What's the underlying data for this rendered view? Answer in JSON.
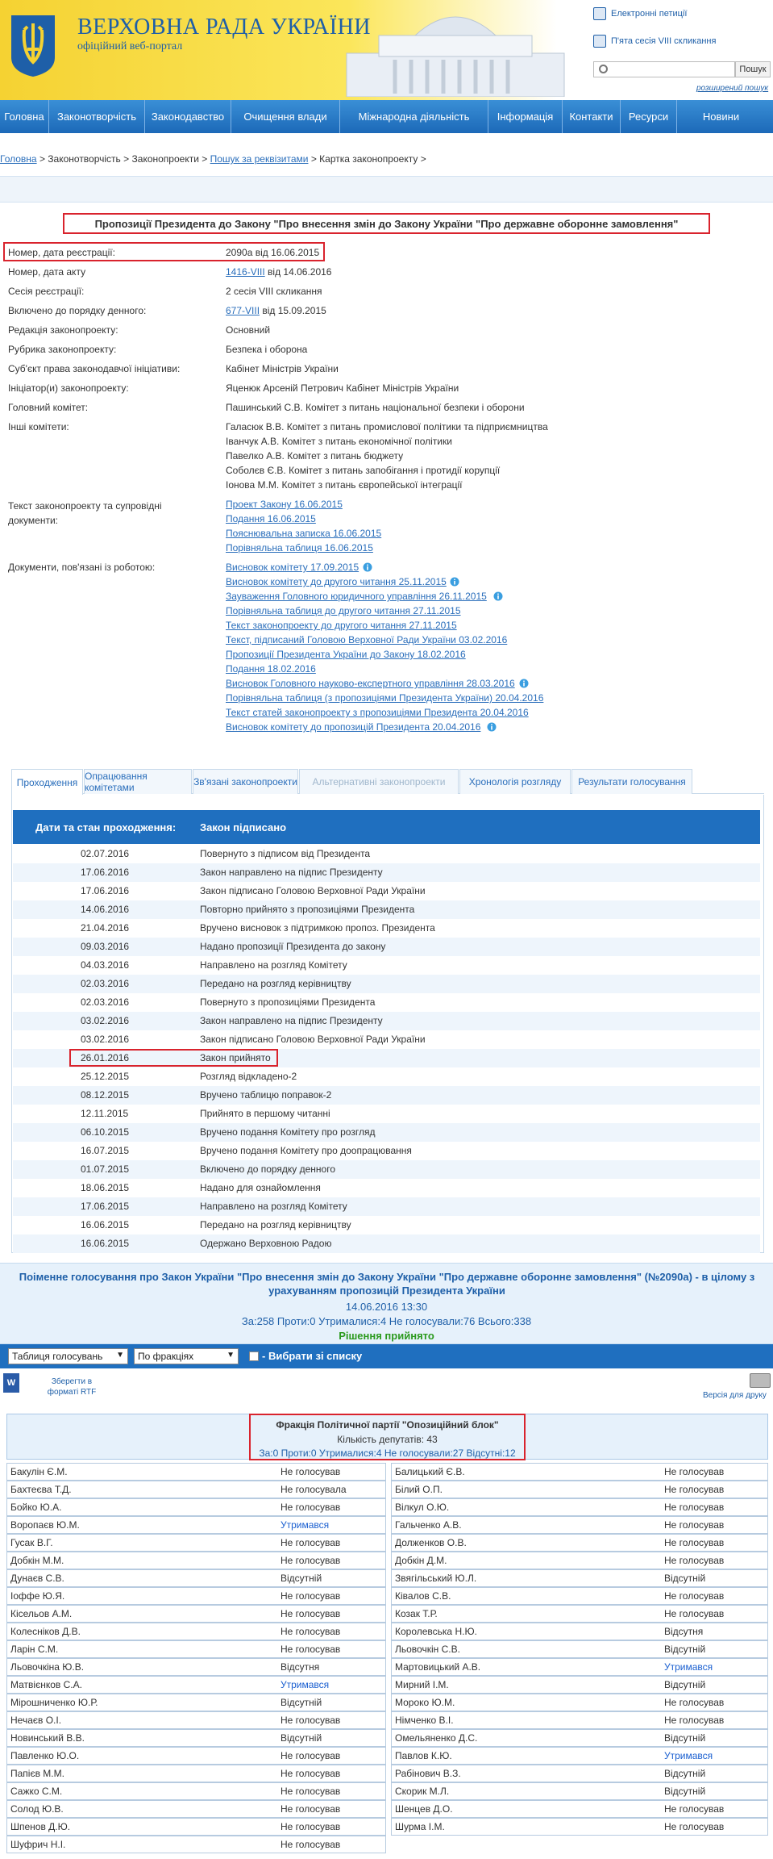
{
  "header": {
    "title": "ВЕРХОВНА РАДА УКРАЇНИ",
    "subtitle": "офіційний веб-портал",
    "links": [
      "Електронні петиції",
      "П'ята сесія VIII скликання"
    ],
    "search_button": "Пошук",
    "advanced_search": "розширений пошук"
  },
  "nav": [
    "Головна",
    "Законотворчість",
    "Законодавство",
    "Очищення влади",
    "Міжнародна діяльність",
    "Інформація",
    "Контакти",
    "Ресурси",
    "Новини"
  ],
  "breadcrumb": {
    "home": "Головна",
    "sep": ">",
    "b2": "Законотворчість",
    "b3": "Законопроекти",
    "b4": "Пошук за реквізитами",
    "b5": "Картка законопроекту"
  },
  "bill": {
    "title": "Пропозиції Президента до Закону \"Про внесення змін до Закону України \"Про державне оборонне замовлення\"",
    "fields": [
      {
        "label": "Номер, дата реєстрації:",
        "value": "2090а від 16.06.2015"
      },
      {
        "label": "Номер, дата акту",
        "link": "1416-VIII",
        "value": " від 14.06.2016"
      },
      {
        "label": "Сесія реєстрації:",
        "value": "2 сесія VIII скликання"
      },
      {
        "label": "Включено до порядку денного:",
        "link": "677-VIII",
        "value": "  від 15.09.2015"
      },
      {
        "label": "Редакція законопроекту:",
        "value": "Основний"
      },
      {
        "label": "Рубрика законопроекту:",
        "value": "Безпека і оборона"
      },
      {
        "label": "Суб'єкт права законодавчої ініціативи:",
        "value": "Кабінет Міністрів України"
      },
      {
        "label": "Ініціатор(и) законопроекту:",
        "value": "Яценюк Арсеній Петрович Кабінет Міністрів України"
      },
      {
        "label": "Головний комітет:",
        "value": "Пашинський С.В. Комітет з питань національної безпеки і оборони"
      }
    ],
    "other_committees_label": "Інші комітети:",
    "other_committees": [
      "Галасюк В.В. Комітет з питань промислової політики та підприємництва",
      "Іванчук А.В. Комітет з питань економічної політики",
      "Павелко А.В. Комітет з питань бюджету",
      "Соболєв Є.В. Комітет з питань запобігання і протидії корупції",
      "Іонова М.М. Комітет з питань європейської інтеграції"
    ],
    "texts_label_1": "Текст законопроекту та супровідні",
    "texts_label_2": "документи:",
    "texts": [
      "Проект Закону 16.06.2015",
      "Подання 16.06.2015",
      "Пояснювальна записка 16.06.2015",
      "Порівняльна таблиця 16.06.2015"
    ],
    "docs_label": "Документи, пов'язані із роботою:",
    "docs": [
      "Висновок комітету 17.09.2015",
      "Висновок комітету до другого читання 25.11.2015",
      "Зауваження Головного юридичного управління 26.11.2015",
      "Порівняльна таблиця до другого читання 27.11.2015",
      "Текст законопроекту до другого читання 27.11.2015",
      "Текст, підписаний Головою Верховної Ради України 03.02.2016",
      "Пропозиції Президента України до Закону 18.02.2016",
      "Подання 18.02.2016",
      "Висновок Головного науково-експертного управління 28.03.2016",
      "Порівняльна таблиця (з пропозиціями Президента України) 20.04.2016",
      "Текст статей законопроекту з пропозиціями Президента 20.04.2016",
      "Висновок комітету до пропозицій Президента 20.04.2016"
    ]
  },
  "tabs": [
    "Проходження",
    "Опрацювання комітетами",
    "Зв'язані законопроекти",
    "Альтернативні законопроекти",
    "Хронологія розгляду",
    "Результати голосування"
  ],
  "stages": {
    "head_date": "Дати та стан проходження:",
    "head_status": "Закон підписано",
    "rows": [
      [
        "02.07.2016",
        "Повернуто з підписом від Президента"
      ],
      [
        "17.06.2016",
        "Закон направлено на підпис Президенту"
      ],
      [
        "17.06.2016",
        "Закон підписано Головою Верховної Ради України"
      ],
      [
        "14.06.2016",
        "Повторно прийнято з пропозиціями Президента"
      ],
      [
        "21.04.2016",
        "Вручено висновок з підтримкою пропоз. Президента"
      ],
      [
        "09.03.2016",
        "Надано пропозиції Президента до закону"
      ],
      [
        "04.03.2016",
        "Направлено на розгляд Комітету"
      ],
      [
        "02.03.2016",
        "Передано на розгляд керівництву"
      ],
      [
        "02.03.2016",
        "Повернуто з пропозиціями Президента"
      ],
      [
        "03.02.2016",
        "Закон направлено на підпис Президенту"
      ],
      [
        "03.02.2016",
        "Закон підписано Головою Верховної Ради України"
      ],
      [
        "26.01.2016",
        "Закон прийнято"
      ],
      [
        "25.12.2015",
        "Розгляд відкладено-2"
      ],
      [
        "08.12.2015",
        "Вручено таблицю поправок-2"
      ],
      [
        "12.11.2015",
        "Прийнято в першому читанні"
      ],
      [
        "06.10.2015",
        "Вручено подання Комітету про розгляд"
      ],
      [
        "16.07.2015",
        "Вручено подання Комітету про доопрацювання"
      ],
      [
        "01.07.2015",
        "Включено до порядку денного"
      ],
      [
        "18.06.2015",
        "Надано для ознайомлення"
      ],
      [
        "17.06.2015",
        "Направлено на розгляд Комітету"
      ],
      [
        "16.06.2015",
        "Передано на розгляд керівництву"
      ],
      [
        "16.06.2015",
        "Одержано Верховною Радою"
      ]
    ]
  },
  "vote": {
    "title": "Поіменне голосування про Закон України \"Про внесення змін до Закону України \"Про державне оборонне замовлення\" (№2090а) - в цілому з урахуванням пропозицій Президента України",
    "datetime": "14.06.2016 13:30",
    "counts": "За:258 Проти:0 Утрималися:4 Не голосували:76 Всього:338",
    "decision": "Рішення прийнято",
    "select1": "Таблиця голосувань",
    "select2": "По фракціях",
    "checkbox_label": "- Вибрати зі списку",
    "rtf_icon": "W",
    "rtf_label": "Зберегти в форматі RTF",
    "print_label": "Версія для друку",
    "faction": {
      "name": "Фракція Політичної партії \"Опозиційний блок\"",
      "count": "Кількість депутатів: 43",
      "result": "За:0 Проти:0 Утрималися:4 Не голосували:27 Відсутні:12"
    },
    "left": [
      [
        "Бакулін Є.М.",
        "Не голосував"
      ],
      [
        "Бахтеєва Т.Д.",
        "Не голосувала"
      ],
      [
        "Бойко Ю.А.",
        "Не голосував"
      ],
      [
        "Воропаєв Ю.М.",
        "Утримався"
      ],
      [
        "Гусак В.Г.",
        "Не голосував"
      ],
      [
        "Добкін М.М.",
        "Не голосував"
      ],
      [
        "Дунаєв С.В.",
        "Відсутній"
      ],
      [
        "Іоффе Ю.Я.",
        "Не голосував"
      ],
      [
        "Кісельов А.М.",
        "Не голосував"
      ],
      [
        "Колесніков Д.В.",
        "Не голосував"
      ],
      [
        "Ларін С.М.",
        "Не голосував"
      ],
      [
        "Льовочкіна Ю.В.",
        "Відсутня"
      ],
      [
        "Матвієнков С.А.",
        "Утримався"
      ],
      [
        "Мірошниченко Ю.Р.",
        "Відсутній"
      ],
      [
        "Нечаєв О.І.",
        "Не голосував"
      ],
      [
        "Новинський В.В.",
        "Відсутній"
      ],
      [
        "Павленко Ю.О.",
        "Не голосував"
      ],
      [
        "Папієв М.М.",
        "Не голосував"
      ],
      [
        "Сажко С.М.",
        "Не голосував"
      ],
      [
        "Солод Ю.В.",
        "Не голосував"
      ],
      [
        "Шпенов Д.Ю.",
        "Не голосував"
      ],
      [
        "Шуфрич Н.І.",
        "Не голосував"
      ]
    ],
    "right": [
      [
        "Балицький Є.В.",
        "Не голосував"
      ],
      [
        "Білий О.П.",
        "Не голосував"
      ],
      [
        "Вілкул О.Ю.",
        "Не голосував"
      ],
      [
        "Гальченко А.В.",
        "Не голосував"
      ],
      [
        "Долженков О.В.",
        "Не голосував"
      ],
      [
        "Добкін Д.М.",
        "Не голосував"
      ],
      [
        "Звягільський Ю.Л.",
        "Відсутній"
      ],
      [
        "Ківалов С.В.",
        "Не голосував"
      ],
      [
        "Козак Т.Р.",
        "Не голосував"
      ],
      [
        "Королевська Н.Ю.",
        "Відсутня"
      ],
      [
        "Льовочкін С.В.",
        "Відсутній"
      ],
      [
        "Мартовицький А.В.",
        "Утримався"
      ],
      [
        "Мирний І.М.",
        "Відсутній"
      ],
      [
        "Мороко Ю.М.",
        "Не голосував"
      ],
      [
        "Німченко В.І.",
        "Не голосував"
      ],
      [
        "Омельяненко Д.С.",
        "Відсутній"
      ],
      [
        "Павлов К.Ю.",
        "Утримався"
      ],
      [
        "Рабінович В.З.",
        "Відсутній"
      ],
      [
        "Скорик М.Л.",
        "Відсутній"
      ],
      [
        "Шенцев Д.О.",
        "Не голосував"
      ],
      [
        "Шурма І.М.",
        "Не голосував"
      ]
    ]
  }
}
